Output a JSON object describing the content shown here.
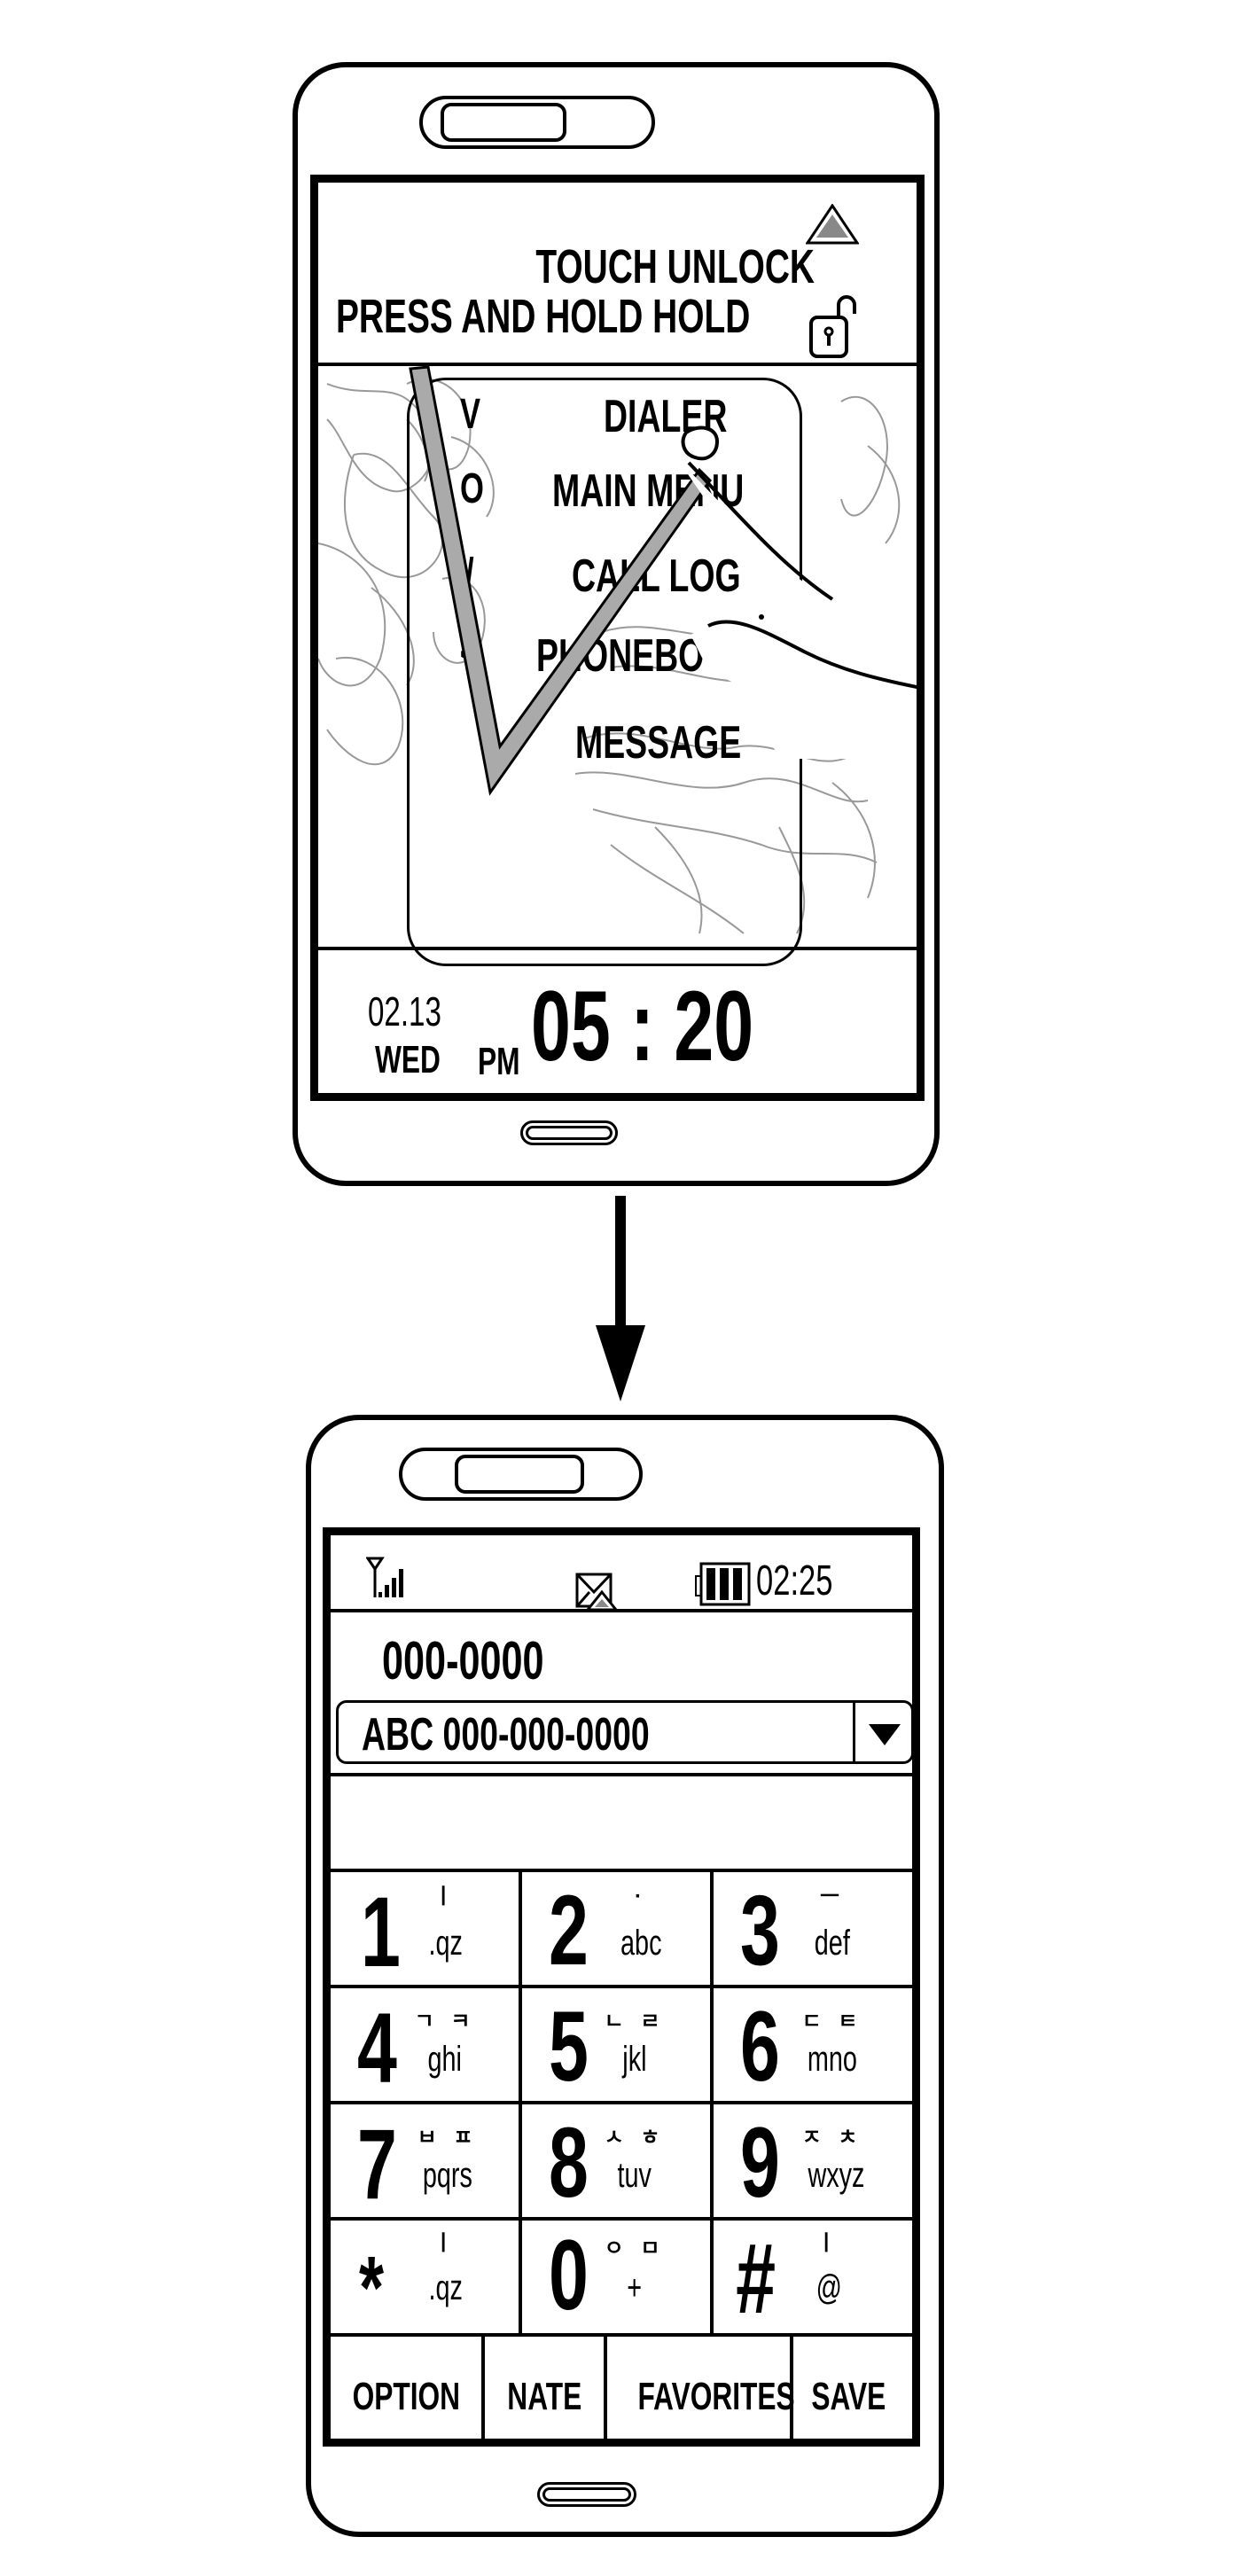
{
  "lock_screen": {
    "unlock_line1": "TOUCH UNLOCK",
    "unlock_line2": "PRESS AND HOLD HOLD",
    "up_icon": "triangle-up-icon",
    "lock_icon": "unlocked-padlock-icon",
    "gesture_letters": [
      "V",
      "O",
      "/",
      "<"
    ],
    "menu_items": [
      "DIALER",
      "MAIN MENU",
      "CALL LOG",
      "PHONEBOOK",
      "MESSAGE"
    ],
    "gesture_drawn": "V",
    "date": "02.13",
    "weekday": "WED",
    "ampm": "PM",
    "time": "05 : 20"
  },
  "transition_icon": "arrow-down-icon",
  "dialer_screen": {
    "status_bar": {
      "signal_icon": "signal-strength-icon",
      "message_icon": "envelope-icon",
      "battery_icon": "battery-full-icon",
      "battery_bars": 3,
      "time": "02:25"
    },
    "dialed_number": "000-0000",
    "suggestion": {
      "value": "ABC 000-000-0000",
      "dropdown_icon": "dropdown-arrow-icon"
    },
    "keypad": [
      {
        "num": "1",
        "kor": "ㅣ",
        "sub": ".qz"
      },
      {
        "num": "2",
        "kor": "·",
        "sub": "abc"
      },
      {
        "num": "3",
        "kor": "ㅡ",
        "sub": "def"
      },
      {
        "num": "4",
        "kor": "ㄱ ㅋ",
        "sub": "ghi"
      },
      {
        "num": "5",
        "kor": "ㄴ ㄹ",
        "sub": "jkl"
      },
      {
        "num": "6",
        "kor": "ㄷ ㅌ",
        "sub": "mno"
      },
      {
        "num": "7",
        "kor": "ㅂ ㅍ",
        "sub": "pqrs"
      },
      {
        "num": "8",
        "kor": "ㅅ ㅎ",
        "sub": "tuv"
      },
      {
        "num": "9",
        "kor": "ㅈ ㅊ",
        "sub": "wxyz"
      },
      {
        "num": "*",
        "kor": "ㅣ",
        "sub": ".qz"
      },
      {
        "num": "0",
        "kor": "ㅇ ㅁ",
        "sub": "+"
      },
      {
        "num": "#",
        "kor": "ㅣ",
        "sub": "@"
      }
    ],
    "softkeys": [
      "OPTION",
      "NATE",
      "FAVORITES",
      "SAVE"
    ]
  }
}
